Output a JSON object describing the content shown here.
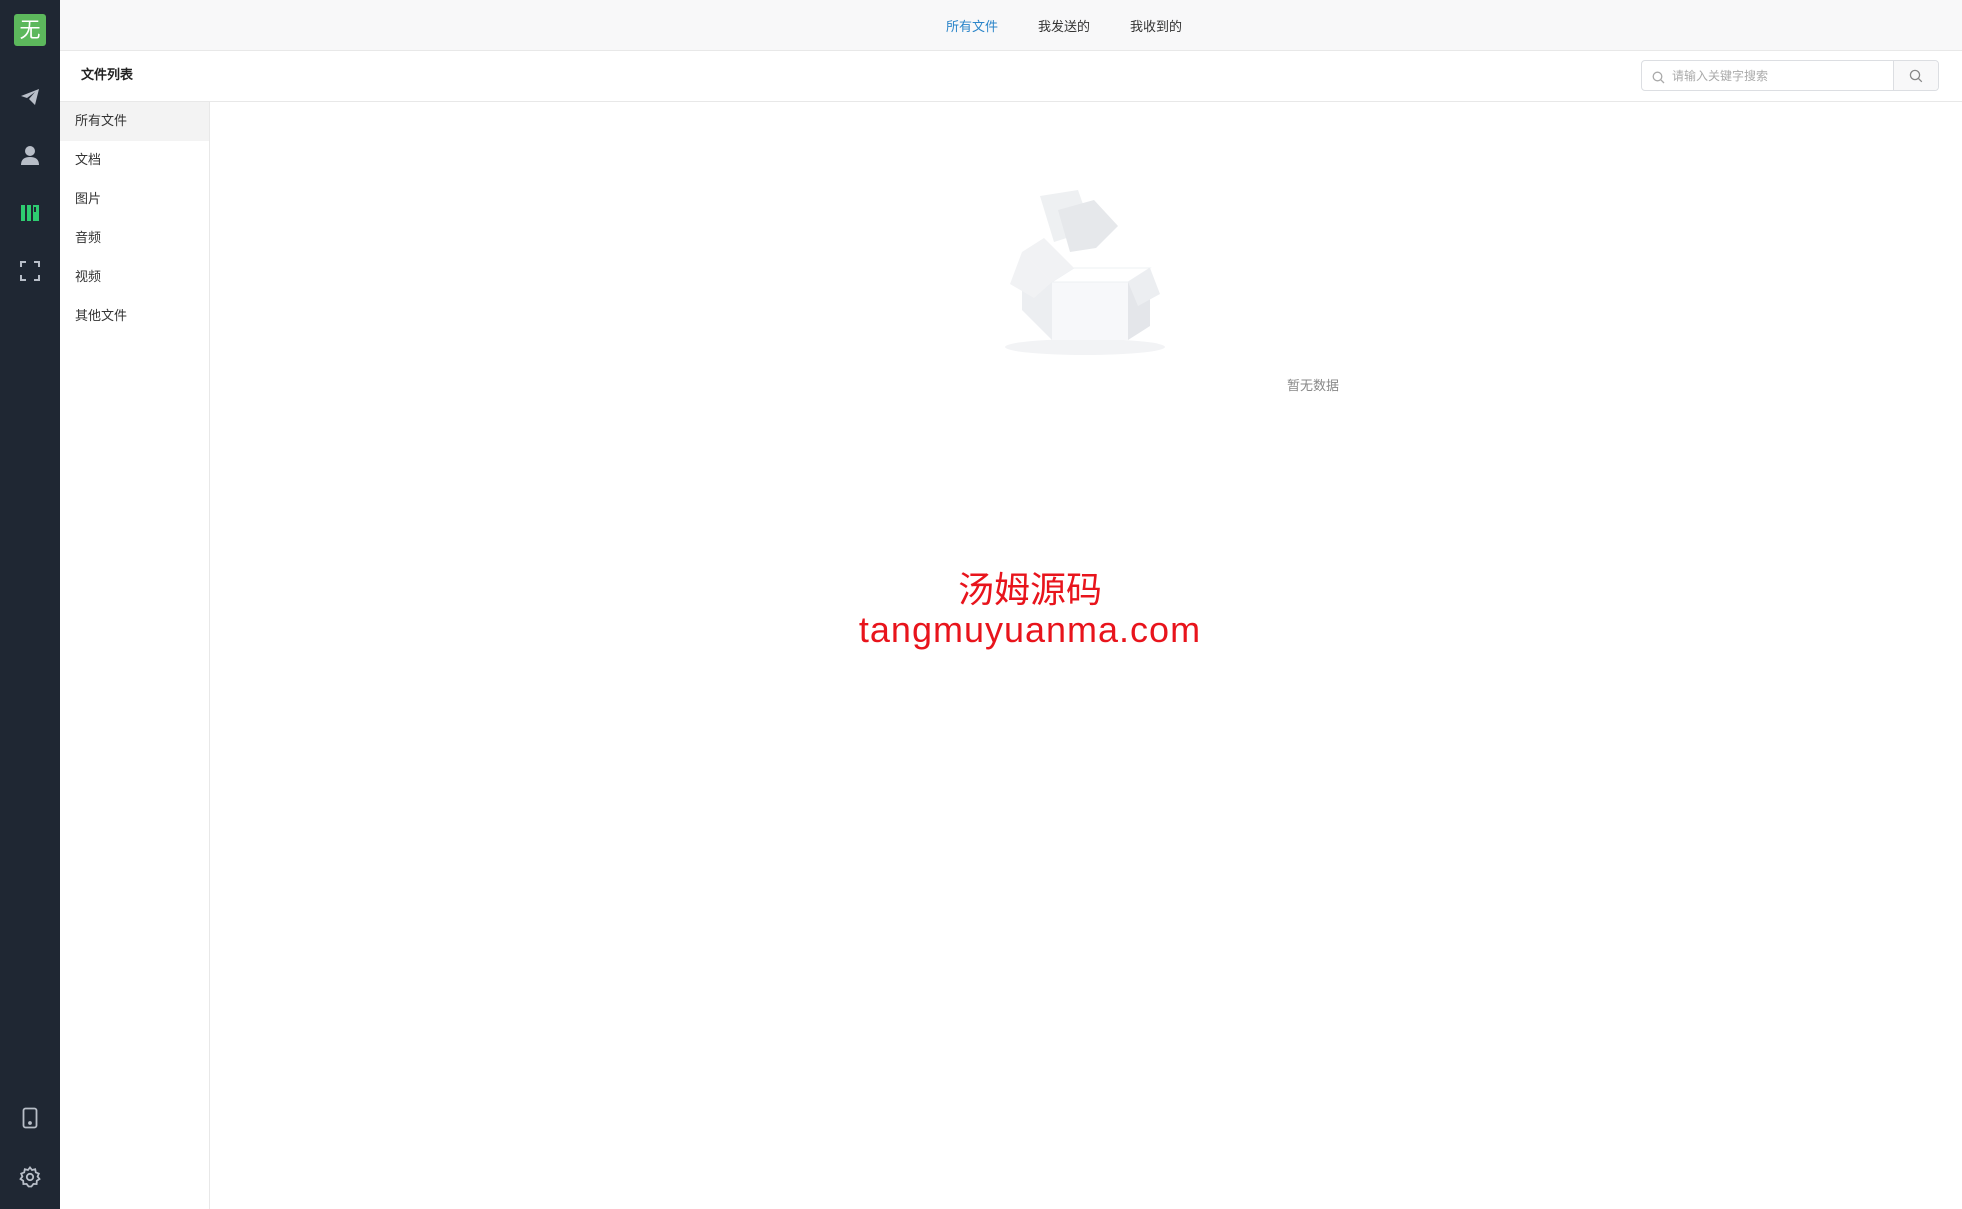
{
  "rail": {
    "logo_char": "无",
    "icons": [
      "send-icon",
      "user-icon",
      "files-icon",
      "scan-icon",
      "mobile-icon",
      "settings-icon"
    ],
    "active_color": "#2ecc71",
    "icon_color": "#b8bec8"
  },
  "topbar": {
    "tabs": [
      {
        "label": "所有文件",
        "active": true
      },
      {
        "label": "我发送的",
        "active": false
      },
      {
        "label": "我收到的",
        "active": false
      }
    ],
    "active_color": "#2b85c9"
  },
  "header": {
    "title": "文件列表",
    "search_placeholder": "请输入关键字搜索",
    "search_value": ""
  },
  "categories": [
    {
      "label": "所有文件",
      "active": true
    },
    {
      "label": "文档",
      "active": false
    },
    {
      "label": "图片",
      "active": false
    },
    {
      "label": "音频",
      "active": false
    },
    {
      "label": "视频",
      "active": false
    },
    {
      "label": "其他文件",
      "active": false
    }
  ],
  "main": {
    "empty_text": "暂无数据"
  },
  "watermark": {
    "line1": "汤姆源码",
    "line2": "tangmuyuanma.com"
  }
}
